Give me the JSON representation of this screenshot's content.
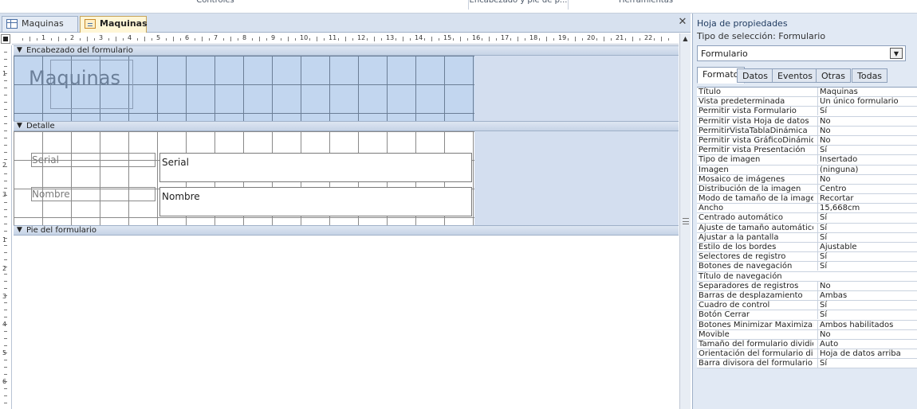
{
  "ribbon": {
    "groups": [
      "Controles",
      "Encabezado y pie de p...",
      "Herramientas"
    ]
  },
  "doc_tabs": [
    {
      "label": "Maquinas",
      "active": false
    },
    {
      "label": "Maquinas",
      "active": true
    }
  ],
  "ruler": {
    "h": [
      "1",
      "2",
      "3",
      "4",
      "5",
      "6",
      "7",
      "8",
      "9",
      "10",
      "11",
      "12",
      "13",
      "14",
      "15",
      "16",
      "17",
      "18",
      "19",
      "20",
      "21",
      "22"
    ],
    "v": [
      "1",
      "2",
      "3",
      "1",
      "2",
      "3",
      "4",
      "5",
      "6"
    ]
  },
  "sections": {
    "header": "Encabezado del formulario",
    "detail": "Detalle",
    "footer": "Pie del formulario"
  },
  "form": {
    "title": "Maquinas",
    "fields": [
      {
        "label": "Serial",
        "control": "Serial"
      },
      {
        "label": "Nombre",
        "control": "Nombre"
      }
    ]
  },
  "property_sheet": {
    "title": "Hoja de propiedades",
    "selection_type": "Tipo de selección:  Formulario",
    "selected": "Formulario",
    "tabs": [
      "Formato",
      "Datos",
      "Eventos",
      "Otras",
      "Todas"
    ],
    "rows": [
      [
        "Título",
        "Maquinas"
      ],
      [
        "Vista predeterminada",
        "Un único formulario"
      ],
      [
        "Permitir vista Formulario",
        "Sí"
      ],
      [
        "Permitir vista Hoja de datos",
        "No"
      ],
      [
        "PermitirVistaTablaDinámica",
        "No"
      ],
      [
        "Permitir vista GráficoDinámico",
        "No"
      ],
      [
        "Permitir vista Presentación",
        "Sí"
      ],
      [
        "Tipo de imagen",
        "Insertado"
      ],
      [
        "Imagen",
        "(ninguna)"
      ],
      [
        "Mosaico de imágenes",
        "No"
      ],
      [
        "Distribución de la imagen",
        "Centro"
      ],
      [
        "Modo de tamaño de la imagen",
        "Recortar"
      ],
      [
        "Ancho",
        "15,668cm"
      ],
      [
        "Centrado automático",
        "Sí"
      ],
      [
        "Ajuste de tamaño automático",
        "Sí"
      ],
      [
        "Ajustar a la pantalla",
        "Sí"
      ],
      [
        "Estilo de los bordes",
        "Ajustable"
      ],
      [
        "Selectores de registro",
        "Sí"
      ],
      [
        "Botones de navegación",
        "Sí"
      ],
      [
        "Título de navegación",
        ""
      ],
      [
        "Separadores de registros",
        "No"
      ],
      [
        "Barras de desplazamiento",
        "Ambas"
      ],
      [
        "Cuadro de control",
        "Sí"
      ],
      [
        "Botón Cerrar",
        "Sí"
      ],
      [
        "Botones Minimizar Maximizar",
        "Ambos habilitados"
      ],
      [
        "Movible",
        "No"
      ],
      [
        "Tamaño del formulario dividido",
        "Auto"
      ],
      [
        "Orientación del formulario dividido",
        "Hoja de datos arriba"
      ],
      [
        "Barra divisora del formulario",
        "Sí"
      ]
    ]
  }
}
